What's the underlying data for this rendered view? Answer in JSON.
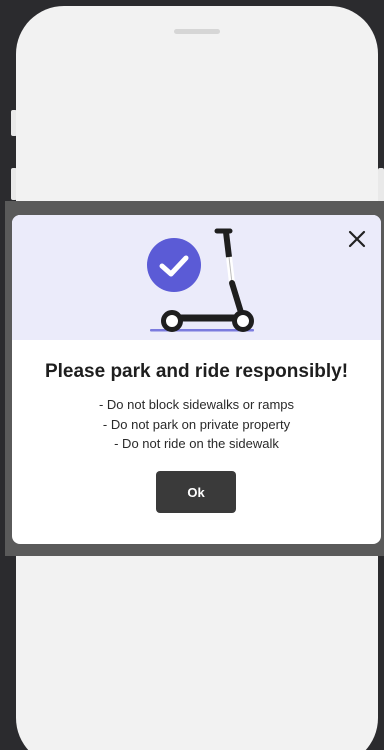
{
  "modal": {
    "title": "Please park and ride responsibly!",
    "rules": [
      "- Do not block sidewalks or ramps",
      "- Do not park on private property",
      "- Do not ride on the sidewalk"
    ],
    "ok_label": "Ok",
    "hero_background": "#ebebfa",
    "check_badge_color": "#5b5bd6",
    "close_icon": "close-icon",
    "illustration_icon": "scooter-icon",
    "badge_icon": "check-circle-icon"
  }
}
